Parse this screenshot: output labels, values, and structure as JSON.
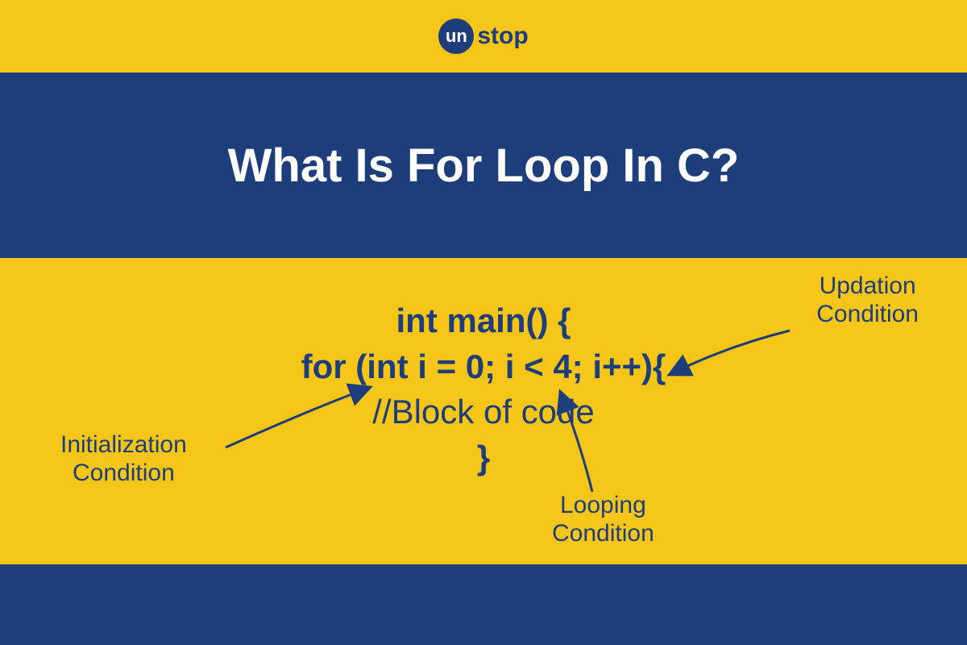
{
  "logo": {
    "circle_text": "un",
    "word": "stop"
  },
  "title": "What Is For Loop In C?",
  "code": {
    "line1": "int main() {",
    "line2": "for (int i = 0; i < 4; i++){",
    "line3": "//Block of code",
    "line4": "}"
  },
  "annotations": {
    "updation": {
      "l1": "Updation",
      "l2": "Condition"
    },
    "initialization": {
      "l1": "Initialization",
      "l2": "Condition"
    },
    "looping": {
      "l1": "Looping",
      "l2": "Condition"
    }
  },
  "colors": {
    "blue": "#1d3e7a",
    "yellow": "#f5c518",
    "white": "#ffffff"
  }
}
